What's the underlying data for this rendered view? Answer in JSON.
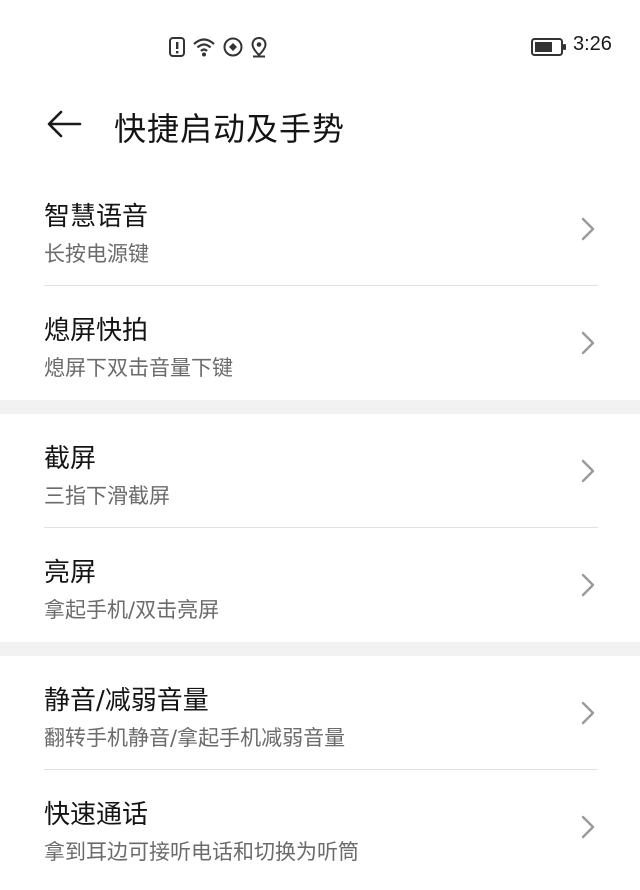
{
  "status_bar": {
    "time": "3:26",
    "icons": [
      "alert-icon",
      "wifi-icon",
      "location-sync-icon",
      "location-pin-icon"
    ],
    "battery_level": 0.7
  },
  "header": {
    "title": "快捷启动及手势",
    "back_icon": "back-arrow-icon"
  },
  "groups": [
    {
      "items": [
        {
          "title": "智慧语音",
          "subtitle": "长按电源键"
        },
        {
          "title": "熄屏快拍",
          "subtitle": "熄屏下双击音量下键"
        }
      ]
    },
    {
      "items": [
        {
          "title": "截屏",
          "subtitle": "三指下滑截屏"
        },
        {
          "title": "亮屏",
          "subtitle": "拿起手机/双击亮屏"
        }
      ]
    },
    {
      "items": [
        {
          "title": "静音/减弱音量",
          "subtitle": "翻转手机静音/拿起手机减弱音量"
        },
        {
          "title": "快速通话",
          "subtitle": "拿到耳边可接听电话和切换为听筒"
        }
      ]
    }
  ],
  "colors": {
    "background": "#ffffff",
    "group_gap": "#f2f2f2",
    "title_text": "#141414",
    "subtitle_text": "#6b6b6b",
    "divider": "#e2e2e2",
    "chevron": "#9a9a9a"
  }
}
